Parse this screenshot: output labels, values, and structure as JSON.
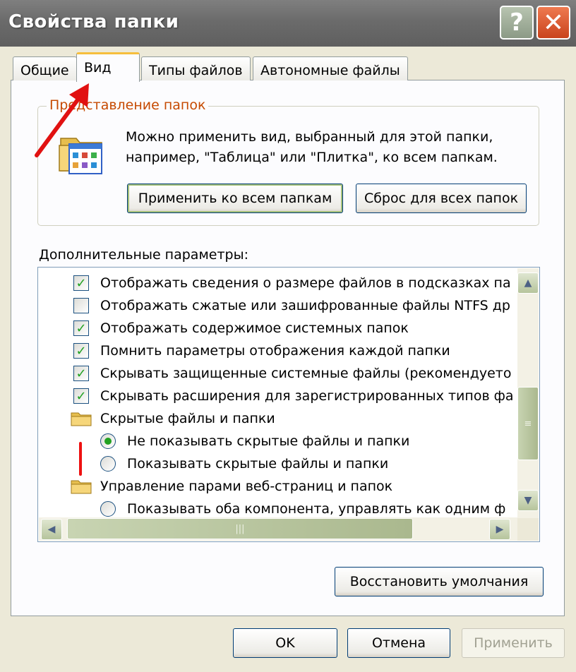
{
  "window": {
    "title": "Свойства папки",
    "help_label": "?",
    "close_label": "✕"
  },
  "tabs": [
    {
      "label": "Общие",
      "active": false
    },
    {
      "label": "Вид",
      "active": true
    },
    {
      "label": "Типы файлов",
      "active": false
    },
    {
      "label": "Автономные файлы",
      "active": false
    }
  ],
  "folder_view": {
    "legend": "Представление папок",
    "description_line1": "Можно применить вид, выбранный для этой папки,",
    "description_line2": "например, \"Таблица\" или \"Плитка\", ко всем папкам.",
    "apply_all_label": "Применить ко всем папкам",
    "reset_all_label": "Сброс для всех папок"
  },
  "advanced": {
    "label": "Дополнительные параметры:",
    "items": [
      {
        "type": "checkbox",
        "checked": true,
        "text": "Отображать сведения о размере файлов в подсказках па"
      },
      {
        "type": "checkbox",
        "checked": false,
        "text": "Отображать сжатые или зашифрованные файлы NTFS др"
      },
      {
        "type": "checkbox",
        "checked": true,
        "text": "Отображать содержимое системных папок"
      },
      {
        "type": "checkbox",
        "checked": true,
        "text": "Помнить параметры отображения каждой папки"
      },
      {
        "type": "checkbox",
        "checked": true,
        "text": "Скрывать защищенные системные файлы (рекомендуето"
      },
      {
        "type": "checkbox",
        "checked": true,
        "text": "Скрывать расширения для зарегистрированных типов фа"
      },
      {
        "type": "folder",
        "text": "Скрытые файлы и папки"
      },
      {
        "type": "radio",
        "checked": true,
        "text": "Не показывать скрытые файлы и папки"
      },
      {
        "type": "radio",
        "checked": false,
        "text": "Показывать скрытые файлы и папки"
      },
      {
        "type": "folder",
        "text": "Управление парами веб-страниц и папок"
      },
      {
        "type": "radio",
        "checked": false,
        "text": "Показывать оба компонента, управлять как одним ф"
      }
    ]
  },
  "restore_defaults_label": "Восстановить умолчания",
  "dialog_buttons": {
    "ok": "OK",
    "cancel": "Отмена",
    "apply": "Применить"
  },
  "colors": {
    "accent_tab": "#F6BE3C",
    "legend_text": "#C64A00",
    "checkmark": "#21A121",
    "annotation": "#E11111"
  }
}
